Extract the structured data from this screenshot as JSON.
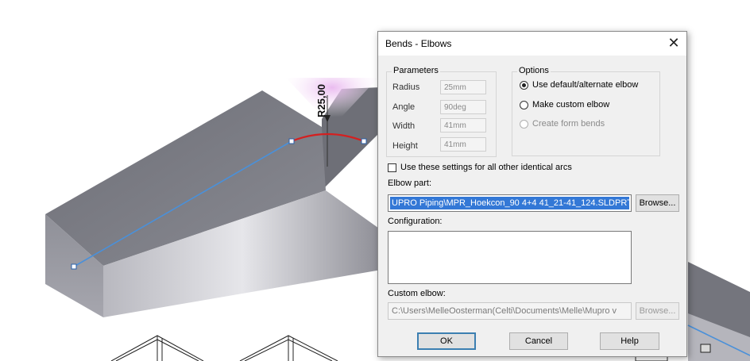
{
  "viewport": {
    "dimension_label": "R25,00"
  },
  "dialog": {
    "title": "Bends - Elbows",
    "close_symbol": "✕",
    "parameters": {
      "group_label": "Parameters",
      "radius_label": "Radius",
      "radius_value": "25mm",
      "angle_label": "Angle",
      "angle_value": "90deg",
      "width_label": "Width",
      "width_value": "41mm",
      "height_label": "Height",
      "height_value": "41mm"
    },
    "options": {
      "group_label": "Options",
      "default_elbow": "Use default/alternate elbow",
      "custom_elbow": "Make custom elbow",
      "form_bends": "Create form bends",
      "selected": "Use default/alternate elbow"
    },
    "use_settings_label": "Use these settings for all other identical arcs",
    "use_settings_checked": false,
    "elbow_part_label": "Elbow part:",
    "elbow_part_value": "UPRO Piping\\MPR_Hoekcon_90 4+4 41_21-41_124.SLDPRT",
    "browse_label": "Browse...",
    "configuration_label": "Configuration:",
    "configuration_value": "",
    "custom_elbow_label": "Custom elbow:",
    "custom_elbow_value": "C:\\Users\\MelleOosterman(Celti\\Documents\\Melle\\Mupro v",
    "browse_disabled_label": "Browse...",
    "ok_label": "OK",
    "cancel_label": "Cancel",
    "help_label": "Help"
  },
  "colors": {
    "sketch_line": "#4a90d9",
    "arc": "#d42020",
    "selection": "#3378d6",
    "model_top": "#7b7c84",
    "model_side": "#9a9aa3"
  }
}
